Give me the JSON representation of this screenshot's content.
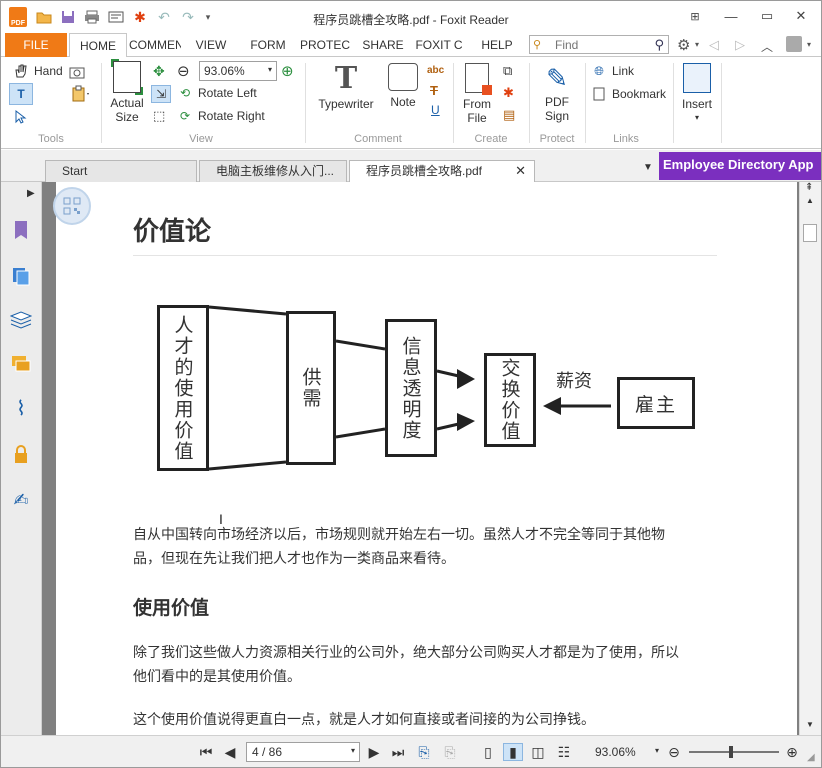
{
  "app": {
    "title": "程序员跳槽全攻略.pdf - Foxit Reader",
    "accent_color": "#f07a16",
    "menu_tabs": [
      "FILE",
      "HOME",
      "COMMEN",
      "VIEW",
      "FORM",
      "PROTEC",
      "SHARE",
      "FOXIT C",
      "HELP"
    ],
    "find_placeholder": "Find"
  },
  "ribbon": {
    "tools": {
      "hand": "Hand",
      "label": "Tools"
    },
    "view": {
      "zoom": "93.06%",
      "actual_size_line1": "Actual",
      "actual_size_line2": "Size",
      "rotate_left": "Rotate Left",
      "rotate_right": "Rotate Right",
      "label": "View"
    },
    "comment": {
      "typewriter": "Typewriter",
      "note": "Note",
      "label": "Comment"
    },
    "create": {
      "from_file_line1": "From",
      "from_file_line2": "File",
      "label": "Create"
    },
    "protect": {
      "pdf_sign_line1": "PDF",
      "pdf_sign_line2": "Sign",
      "label": "Protect"
    },
    "links": {
      "link": "Link",
      "bookmark": "Bookmark",
      "label": "Links"
    },
    "insert": {
      "label": "Insert"
    }
  },
  "doc_tabs": [
    {
      "label": "Start"
    },
    {
      "label": "电脑主板维修从入门..."
    },
    {
      "label": "程序员跳槽全攻略.pdf"
    }
  ],
  "promo": {
    "label": "Employee Directory App",
    "color": "#7b2fbf"
  },
  "page": {
    "heading": "价值论",
    "diagram": {
      "box1": "人才的使用价值",
      "box2": "供需",
      "box3": "信息透明度",
      "box4": "交换价值",
      "box5": "雇主",
      "salary_label": "薪资"
    },
    "para1_line1": "自从中国转向市场经济以后，市场规则就开始左右一切。虽然人才不完全等同于其他物",
    "para1_line2": "品，但现在先让我们把人才也作为一类商品来看待。",
    "subheading": "使用价值",
    "para2_line1": "除了我们这些做人力资源相关行业的公司外，绝大部分公司购买人才都是为了使用，所以",
    "para2_line2": "他们看中的是其使用价值。",
    "para3_line1": "这个使用价值说得更直白一点，就是人才如何直接或者间接的为公司挣钱。"
  },
  "status": {
    "page_indicator": "4 / 86",
    "zoom": "93.06%"
  }
}
